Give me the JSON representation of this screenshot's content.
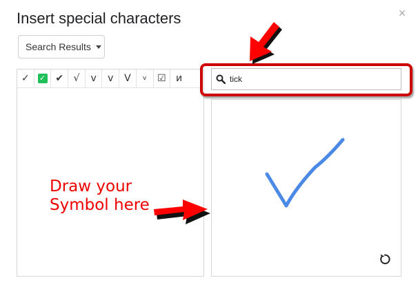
{
  "dialog": {
    "title": "Insert special characters",
    "close_label": "×",
    "category_dropdown": "Search Results",
    "search": {
      "value": "tick"
    },
    "results": [
      "✓",
      "✅",
      "✔",
      "√",
      "v",
      "v",
      "V",
      "v",
      "☑",
      "и"
    ],
    "annotation": "Draw your\nSymbol here",
    "colors": {
      "stroke": "#4a8ae6",
      "annotation": "#ee0000",
      "highlight": "#cc0000",
      "arrow_fill": "#ff0000"
    },
    "icons": [
      "search-icon",
      "redo-icon",
      "close-icon",
      "caret-down-icon"
    ]
  }
}
